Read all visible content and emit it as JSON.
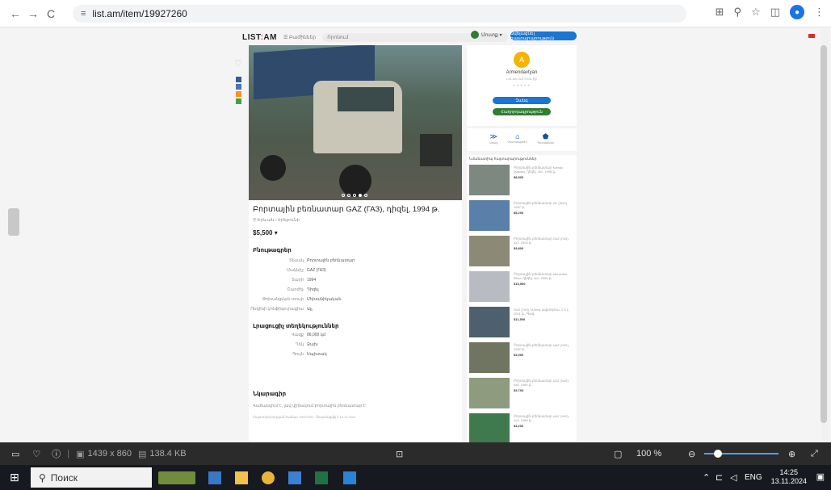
{
  "browser": {
    "url": "list.am/item/19927260",
    "back": "←",
    "forward": "→",
    "reload": "C",
    "tune_icon": "≡",
    "translate_icon": "⊞",
    "zoom_icon": "⚲",
    "star_icon": "☆",
    "sidepanel_icon": "◫",
    "profile_initial": "⚲",
    "menu_icon": "⋮"
  },
  "site": {
    "logo_left": "LIST",
    "logo_colon": ":",
    "logo_right": "AM",
    "categories": "☰ Բաժիններ",
    "search_placeholder": "Որոնում",
    "login": "Մուտք ▾",
    "post_button": "Ավելացնել հայտարարություն"
  },
  "listing": {
    "title": "Բորտային բեռնատար GAZ (ГАЗ), դիզել, 1994 թ.",
    "location": "⚲ Երևան › Էրեբունի",
    "price": "$5,500 ▾",
    "props_heading": "Բնութագրեր",
    "props": [
      {
        "k": "Տեսակ",
        "v": "Բորտային բեռնատար"
      },
      {
        "k": "Մակնիշ",
        "v": "GAZ (ГАЗ)"
      },
      {
        "k": "Տարի",
        "v": "1994"
      },
      {
        "k": "Շարժիչ",
        "v": "Դիզել"
      },
      {
        "k": "Փոխանցման տուփ",
        "v": "Մեխանիկական"
      },
      {
        "k": "Ռեզինի կոնֆիգուրացիա",
        "v": "Այլ"
      }
    ],
    "extra_heading": "Լրացուցիչ տեղեկություններ",
    "extra": [
      {
        "k": "Վազք",
        "v": "86,000 կմ"
      },
      {
        "k": "Ղեկ",
        "v": "Ձախ"
      },
      {
        "k": "Գույն",
        "v": "Սպիտակ"
      }
    ],
    "desc_heading": "Նկարագիր",
    "desc": "Վաճառվում է, լավ վիճակում բորտային բեռնատար է:",
    "meta": "Հայտարարության համար 19927260 · Թարմացվել է 13.11.2024"
  },
  "seller": {
    "initial": "A",
    "name": "Armendavtyan",
    "since": "List.am-ում 2018-ից",
    "stars": "★★★★★",
    "call": "Զանգ",
    "message": "Հաղորդագրություն"
  },
  "actions": [
    {
      "icon": "≫",
      "label": "Առաջ"
    },
    {
      "icon": "⌂",
      "label": "Չստուգված է"
    },
    {
      "icon": "⬟",
      "label": "Պիտակներ"
    }
  ],
  "similar": {
    "heading": "Նմանատիպ հայտարարություններ",
    "items": [
      {
        "text": "Բորտային բեռնատար Kamaz (Камаз), դիզել, 4x2, 1998 թ.",
        "price": "$8,500"
      },
      {
        "text": "Բորտային բեռնատար ZIL (ЗИЛ), 1997 թ.",
        "price": "$5,200"
      },
      {
        "text": "Բորտային բեռնատար GAZ (ГАЗ), 4x2, 2003 թ.",
        "price": "$3,800"
      },
      {
        "text": "Բորտային բեռնատար Mercedes-Benz, դիզել, 4x2, 2008 թ.",
        "price": "$10,500"
      },
      {
        "text": "GAZ (ГАЗ) ГАЗель ավտոբուս, 2.5 L, 2011 թ., Գազ",
        "price": "$11,500"
      },
      {
        "text": "Բորտային բեռնատար UAZ (УАЗ), 1982 թ.",
        "price": "$3,000"
      },
      {
        "text": "Բորտային բեռնատար UAZ (УАЗ), 4x4, 1984 թ.",
        "price": "$3,700"
      },
      {
        "text": "Բորտային բեռնատար UAZ (УАЗ), 4x4, 1988 թ.",
        "price": "$4,200"
      }
    ]
  },
  "viewer_bar": {
    "resolution": "1439 x 860",
    "size": "138.4 KB",
    "zoom": "100 %"
  },
  "taskbar": {
    "search": "Поиск",
    "lang": "ENG",
    "time": "14:25",
    "date": "13.11.2024"
  }
}
